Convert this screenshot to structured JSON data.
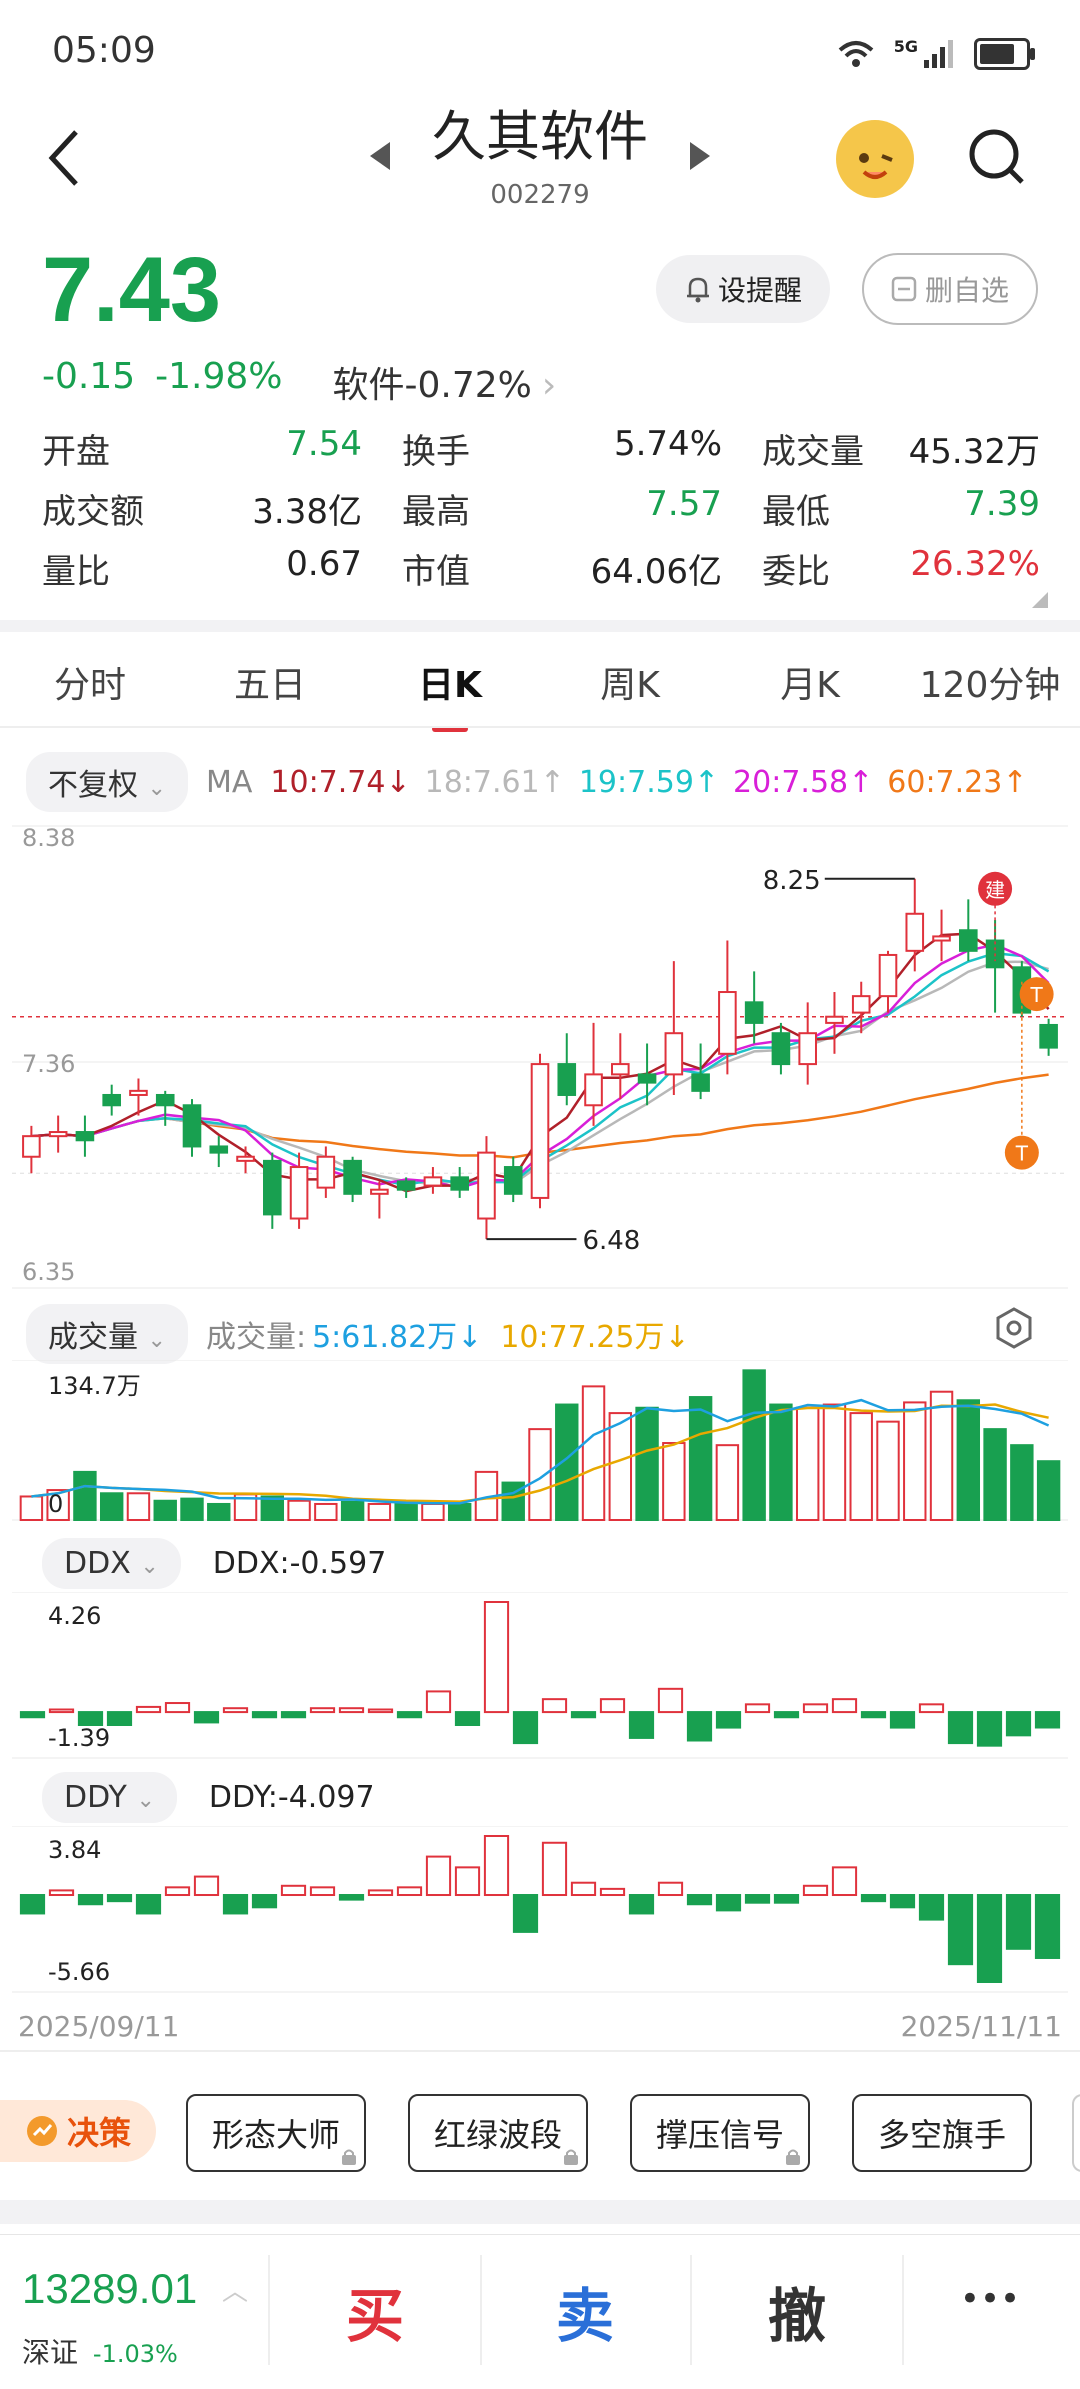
{
  "status_bar": {
    "time": "05:09",
    "network": "5G"
  },
  "header": {
    "title": "久其软件",
    "code": "002279"
  },
  "quote": {
    "price": "7.43",
    "change": "-0.15",
    "change_pct": "-1.98%",
    "sector": "软件-0.72%"
  },
  "actions": {
    "alert": "设提醒",
    "remove_watch": "删自选"
  },
  "stats": [
    [
      {
        "label": "开盘",
        "value": "7.54",
        "color": "#18a050"
      },
      {
        "label": "换手",
        "value": "5.74%",
        "color": "#222222"
      },
      {
        "label": "成交量",
        "value": "45.32万",
        "color": "#222222"
      }
    ],
    [
      {
        "label": "成交额",
        "value": "3.38亿",
        "color": "#222222"
      },
      {
        "label": "最高",
        "value": "7.57",
        "color": "#18a050"
      },
      {
        "label": "最低",
        "value": "7.39",
        "color": "#18a050"
      }
    ],
    [
      {
        "label": "量比",
        "value": "0.67",
        "color": "#222222"
      },
      {
        "label": "市值",
        "value": "64.06亿",
        "color": "#222222"
      },
      {
        "label": "委比",
        "value": "26.32%",
        "color": "#e0323c"
      }
    ]
  ],
  "tabs": [
    "分时",
    "五日",
    "日K",
    "周K",
    "月K",
    "120分钟"
  ],
  "active_tab": "日K",
  "ma_bar": {
    "adjust": "不复权",
    "label": "MA",
    "items": [
      {
        "text": "10:7.74↓",
        "color": "#b0202a"
      },
      {
        "text": "18:7.61↑",
        "color": "#b8b8b8"
      },
      {
        "text": "19:7.59↑",
        "color": "#1cc3c8"
      },
      {
        "text": "20:7.58↑",
        "color": "#d81fd8"
      },
      {
        "text": "60:7.23↑",
        "color": "#f07818"
      }
    ]
  },
  "chart_data": [
    {
      "type": "candlestick",
      "title": "日K",
      "y_top_label": "8.38",
      "y_mid_label": "7.36",
      "y_bottom_label": "6.35",
      "ylim": [
        6.35,
        8.38
      ],
      "annotations": {
        "high": "8.25",
        "low": "6.48",
        "markers": [
          "建",
          "T",
          "T"
        ]
      },
      "candles": [
        {
          "o": 6.9,
          "h": 7.05,
          "l": 6.82,
          "c": 7.0
        },
        {
          "o": 7.0,
          "h": 7.1,
          "l": 6.92,
          "c": 7.02
        },
        {
          "o": 7.02,
          "h": 7.1,
          "l": 6.9,
          "c": 6.98
        },
        {
          "o": 7.2,
          "h": 7.25,
          "l": 7.1,
          "c": 7.15
        },
        {
          "o": 7.2,
          "h": 7.28,
          "l": 7.1,
          "c": 7.22
        },
        {
          "o": 7.2,
          "h": 7.22,
          "l": 7.05,
          "c": 7.15
        },
        {
          "o": 7.15,
          "h": 7.18,
          "l": 6.9,
          "c": 6.95
        },
        {
          "o": 6.95,
          "h": 7.0,
          "l": 6.85,
          "c": 6.92
        },
        {
          "o": 6.88,
          "h": 6.95,
          "l": 6.82,
          "c": 6.9
        },
        {
          "o": 6.88,
          "h": 6.92,
          "l": 6.55,
          "c": 6.62
        },
        {
          "o": 6.6,
          "h": 6.92,
          "l": 6.55,
          "c": 6.85
        },
        {
          "o": 6.75,
          "h": 6.95,
          "l": 6.7,
          "c": 6.9
        },
        {
          "o": 6.88,
          "h": 6.9,
          "l": 6.68,
          "c": 6.72
        },
        {
          "o": 6.72,
          "h": 6.78,
          "l": 6.6,
          "c": 6.74
        },
        {
          "o": 6.78,
          "h": 6.8,
          "l": 6.7,
          "c": 6.74
        },
        {
          "o": 6.76,
          "h": 6.85,
          "l": 6.72,
          "c": 6.8
        },
        {
          "o": 6.8,
          "h": 6.85,
          "l": 6.7,
          "c": 6.74
        },
        {
          "o": 6.6,
          "h": 7.0,
          "l": 6.5,
          "c": 6.92
        },
        {
          "o": 6.85,
          "h": 6.9,
          "l": 6.68,
          "c": 6.72
        },
        {
          "o": 6.7,
          "h": 7.4,
          "l": 6.65,
          "c": 7.35
        },
        {
          "o": 7.35,
          "h": 7.5,
          "l": 7.15,
          "c": 7.2
        },
        {
          "o": 7.15,
          "h": 7.55,
          "l": 7.05,
          "c": 7.3
        },
        {
          "o": 7.3,
          "h": 7.5,
          "l": 7.18,
          "c": 7.35
        },
        {
          "o": 7.3,
          "h": 7.45,
          "l": 7.15,
          "c": 7.26
        },
        {
          "o": 7.3,
          "h": 7.85,
          "l": 7.2,
          "c": 7.5
        },
        {
          "o": 7.3,
          "h": 7.45,
          "l": 7.18,
          "c": 7.22
        },
        {
          "o": 7.4,
          "h": 7.95,
          "l": 7.3,
          "c": 7.7
        },
        {
          "o": 7.65,
          "h": 7.8,
          "l": 7.45,
          "c": 7.55
        },
        {
          "o": 7.5,
          "h": 7.55,
          "l": 7.3,
          "c": 7.35
        },
        {
          "o": 7.35,
          "h": 7.65,
          "l": 7.25,
          "c": 7.5
        },
        {
          "o": 7.55,
          "h": 7.7,
          "l": 7.4,
          "c": 7.58
        },
        {
          "o": 7.6,
          "h": 7.75,
          "l": 7.5,
          "c": 7.68
        },
        {
          "o": 7.68,
          "h": 7.9,
          "l": 7.6,
          "c": 7.88
        },
        {
          "o": 7.9,
          "h": 8.25,
          "l": 7.8,
          "c": 8.08
        },
        {
          "o": 7.95,
          "h": 8.1,
          "l": 7.85,
          "c": 7.97
        },
        {
          "o": 8.0,
          "h": 8.15,
          "l": 7.85,
          "c": 7.9
        },
        {
          "o": 7.95,
          "h": 8.05,
          "l": 7.6,
          "c": 7.82
        },
        {
          "o": 7.82,
          "h": 7.85,
          "l": 7.58,
          "c": 7.6
        },
        {
          "o": 7.54,
          "h": 7.57,
          "l": 7.39,
          "c": 7.43
        }
      ]
    },
    {
      "type": "bar",
      "title": "成交量",
      "label": "成交量:",
      "ma5": "5:61.82万↓",
      "ma10": "10:77.25万↓",
      "y_top_label": "134.7万",
      "y_zero_label": "0",
      "ylim": [
        0,
        134.7
      ],
      "values": [
        22,
        28,
        45,
        25,
        25,
        18,
        20,
        15,
        24,
        22,
        18,
        15,
        17,
        15,
        16,
        15,
        15,
        45,
        35,
        85,
        108,
        125,
        100,
        105,
        72,
        115,
        70,
        140,
        108,
        105,
        108,
        100,
        92,
        110,
        120,
        112,
        85,
        70,
        55
      ]
    },
    {
      "type": "bar",
      "title": "DDX",
      "label": "DDX:-0.597",
      "y_top_label": "4.26",
      "y_bottom_label": "-1.39",
      "ylim": [
        -1.39,
        4.26
      ],
      "values": [
        -0.2,
        0.1,
        -0.5,
        -0.5,
        0.2,
        0.35,
        -0.4,
        0.15,
        -0.2,
        -0.2,
        0.15,
        0.15,
        0.1,
        -0.2,
        0.8,
        -0.5,
        4.26,
        -1.2,
        0.5,
        -0.2,
        0.5,
        -1.0,
        0.9,
        -1.1,
        -0.6,
        0.3,
        -0.2,
        0.3,
        0.5,
        -0.2,
        -0.6,
        0.3,
        -1.2,
        -1.3,
        -0.9,
        -0.597
      ]
    },
    {
      "type": "bar",
      "title": "DDY",
      "label": "DDY:-4.097",
      "y_top_label": "3.84",
      "y_bottom_label": "-5.66",
      "ylim": [
        -5.66,
        3.84
      ],
      "values": [
        -1.2,
        0.3,
        -0.6,
        -0.4,
        -1.2,
        0.5,
        1.2,
        -1.2,
        -0.8,
        0.6,
        0.5,
        -0.3,
        0.3,
        0.5,
        2.5,
        1.8,
        3.84,
        -2.4,
        3.4,
        0.8,
        0.4,
        -1.2,
        0.8,
        -0.6,
        -1.0,
        -0.5,
        -0.5,
        0.6,
        1.8,
        -0.4,
        -0.8,
        -1.6,
        -4.5,
        -5.66,
        -3.5,
        -4.097
      ]
    }
  ],
  "x_labels": {
    "start": "2025/09/11",
    "end": "2025/11/11"
  },
  "volume_bar": {
    "adjust": "成交量"
  },
  "indicator_chips": {
    "ddx": "DDX",
    "ddy": "DDY"
  },
  "tools": {
    "label": "决策",
    "buttons": [
      "形态大师",
      "红绿波段",
      "撑压信号",
      "多空旗手"
    ]
  },
  "footer": {
    "index_value": "13289.01",
    "index_name": "深证",
    "index_change": "-1.03%",
    "buy": "买",
    "sell": "卖",
    "cancel": "撤",
    "more": "•••"
  }
}
